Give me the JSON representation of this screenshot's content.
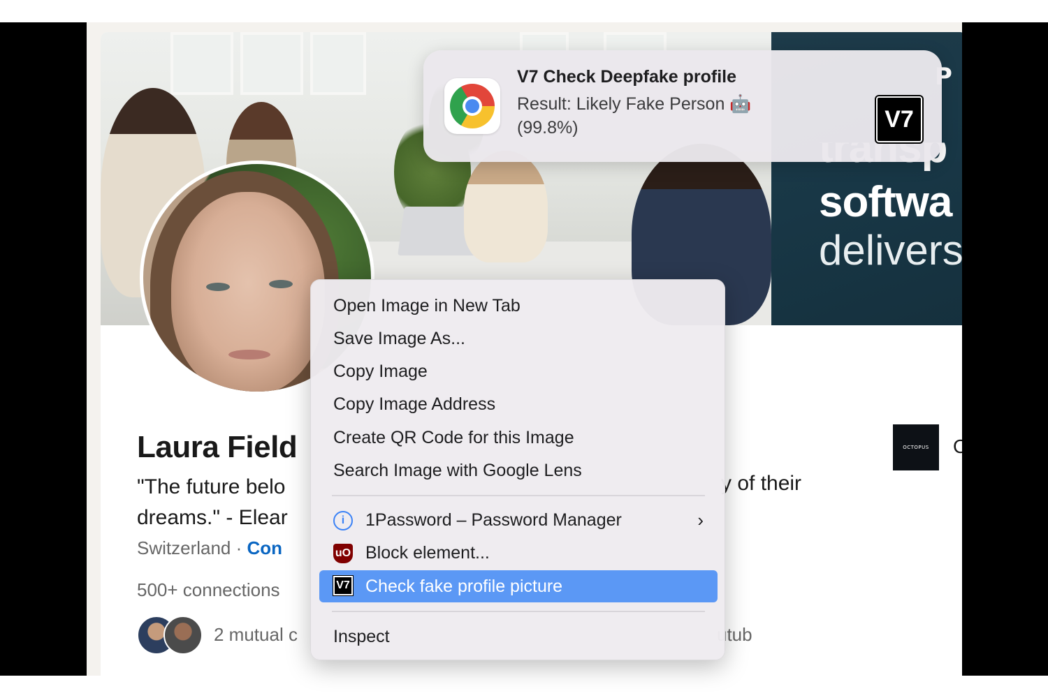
{
  "notification": {
    "title": "V7 Check Deepfake profile",
    "body_line1": "Result: Likely Fake Person 🤖",
    "body_line2": "(99.8%)",
    "app_icon": "chrome-icon",
    "brand_logo": "V7"
  },
  "banner_ad": {
    "corner_text": "P",
    "line1": "transp",
    "line2": "softwa",
    "line3": "delivers"
  },
  "profile": {
    "name": "Laura Field",
    "quote_line1_left": "\"The future belo",
    "quote_line1_right": "y of their",
    "quote_line2": "dreams.\" - Elear",
    "location": "Switzerland · ",
    "contact_link": "Con",
    "connections": "500+ connections",
    "mutual_left": "2 mutual c",
    "mutual_right": "utub",
    "company_logo_text": "OCTOPUS",
    "company_initial": "O"
  },
  "context_menu": {
    "items": [
      {
        "label": "Open Image in New Tab"
      },
      {
        "label": "Save Image As..."
      },
      {
        "label": "Copy Image"
      },
      {
        "label": "Copy Image Address"
      },
      {
        "label": "Create QR Code for this Image"
      },
      {
        "label": "Search Image with Google Lens"
      }
    ],
    "extensions": [
      {
        "label": "1Password – Password Manager",
        "icon": "1password-icon",
        "glyph": "i",
        "has_submenu": true
      },
      {
        "label": "Block element...",
        "icon": "ublock-origin-icon",
        "glyph": "uO"
      },
      {
        "label": "Check fake profile picture",
        "icon": "v7-icon",
        "glyph": "V7",
        "highlighted": true
      }
    ],
    "inspect_label": "Inspect",
    "submenu_chevron": "›"
  },
  "colors": {
    "menu_highlight": "#5b98f5",
    "link_blue": "#0a66c2",
    "ad_background": "#183746"
  }
}
